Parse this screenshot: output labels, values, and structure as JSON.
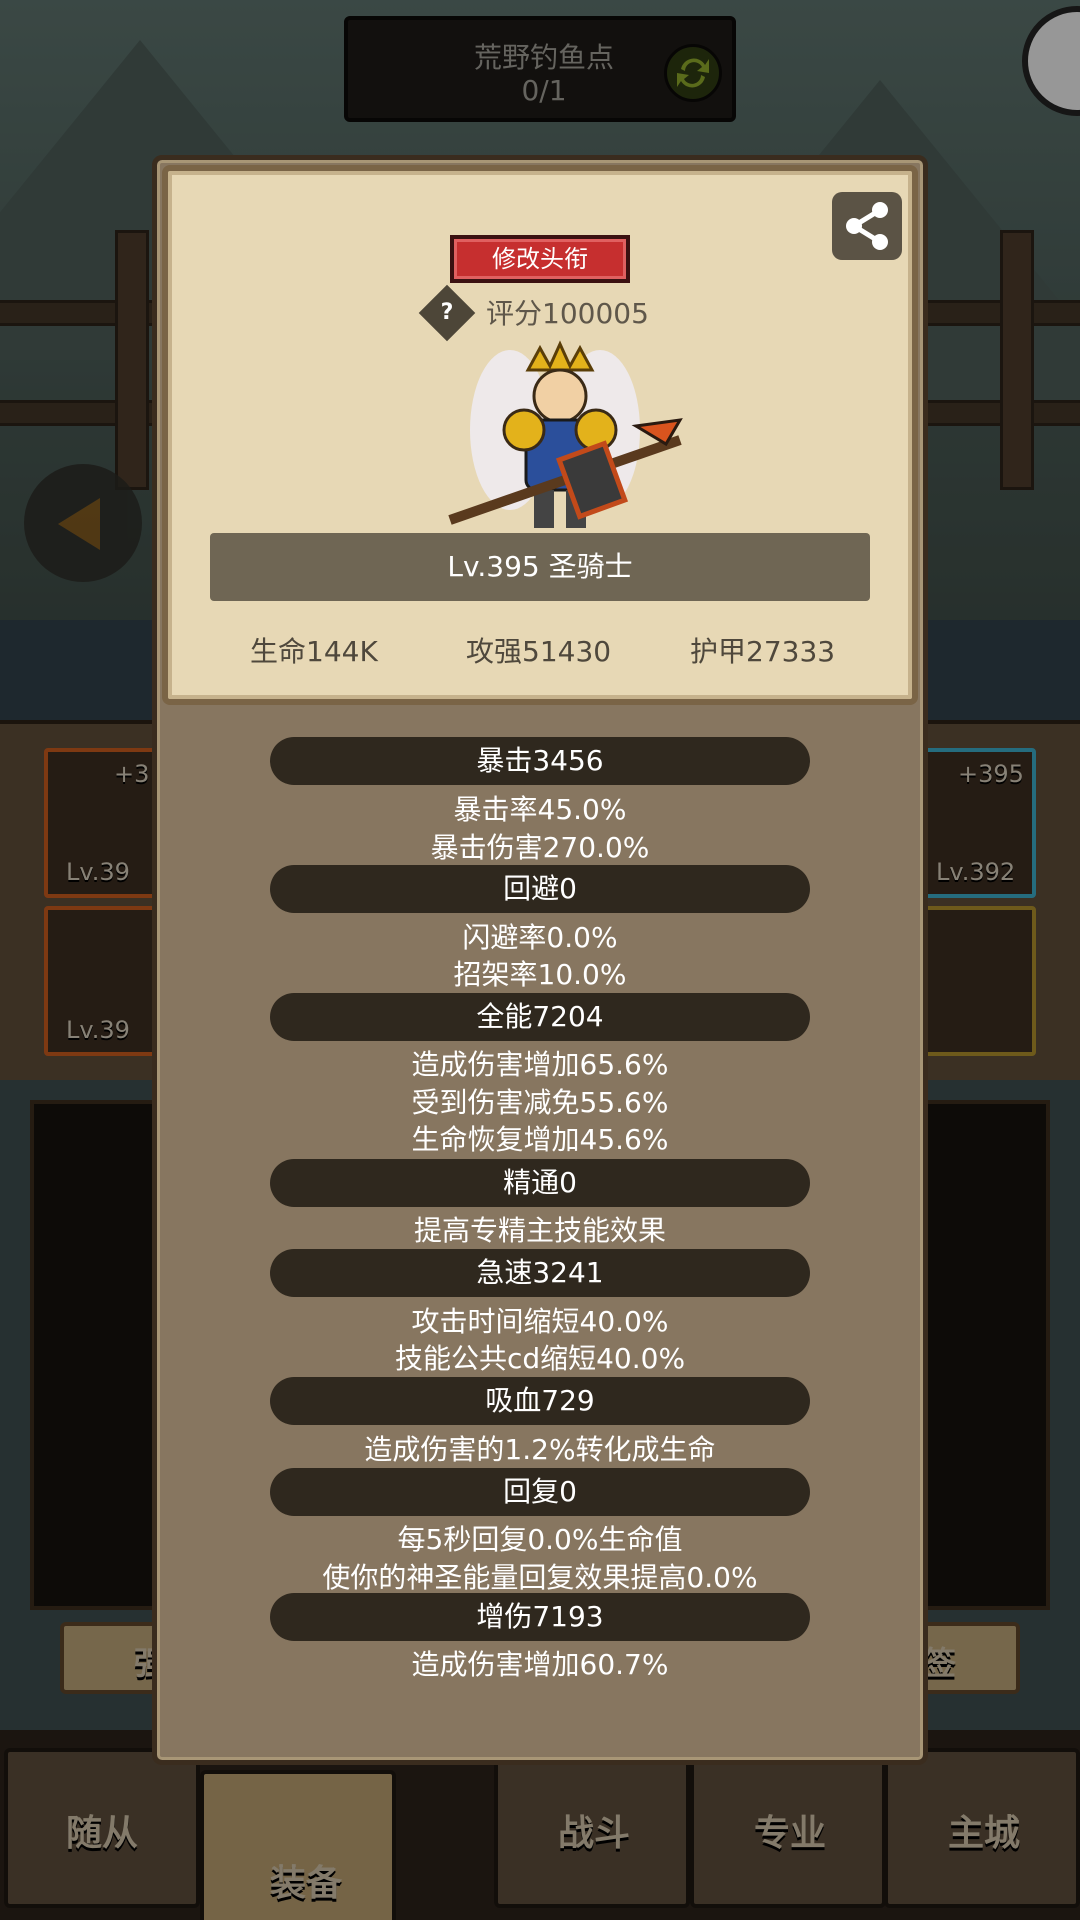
{
  "fishing_spot": {
    "title": "荒野钓鱼点",
    "count": "0/1"
  },
  "equipment_slots": [
    {
      "level_text": "+3",
      "level": "Lv.39"
    },
    {
      "level_text": "+395",
      "level": "Lv.392"
    },
    {
      "level": "Lv.39"
    }
  ],
  "footer_strip": {
    "left": "强",
    "right": "签"
  },
  "tabs": [
    "随从",
    "装备",
    "战斗",
    "专业",
    "主城"
  ],
  "modal": {
    "title_button": "修改头衔",
    "score": "评分100005",
    "level_name": "Lv.395 圣骑士",
    "base_stats": {
      "hp": "生命144K",
      "attack": "攻强51430",
      "armor": "护甲27333"
    },
    "stat_groups": [
      {
        "banner": "暴击3456",
        "lines": [
          "暴击率45.0%",
          "暴击伤害270.0%"
        ]
      },
      {
        "banner": "回避0",
        "lines": [
          "闪避率0.0%",
          "招架率10.0%"
        ]
      },
      {
        "banner": "全能7204",
        "lines": [
          "造成伤害增加65.6%",
          "受到伤害减免55.6%",
          "生命恢复增加45.6%"
        ]
      },
      {
        "banner": "精通0",
        "lines": [
          "提高专精主技能效果"
        ]
      },
      {
        "banner": "急速3241",
        "lines": [
          "攻击时间缩短40.0%",
          "技能公共cd缩短40.0%"
        ]
      },
      {
        "banner": "吸血729",
        "lines": [
          "造成伤害的1.2%转化成生命"
        ]
      },
      {
        "banner": "回复0",
        "lines": [
          "每5秒回复0.0%生命值",
          "使你的神圣能量回复效果提高0.0%"
        ]
      },
      {
        "banner": "增伤7193",
        "lines": [
          "造成伤害增加60.7%"
        ]
      }
    ]
  },
  "colors": {
    "title_button": "#c62f2f",
    "modal_bg": "#877660",
    "card_bg": "#e7d8b5",
    "banner_bg": "#2f281e"
  }
}
